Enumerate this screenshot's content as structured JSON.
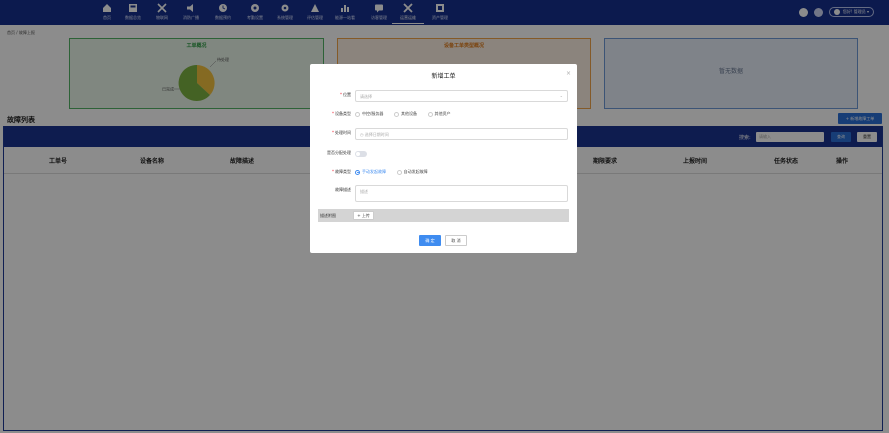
{
  "nav": {
    "items": [
      {
        "label": "首页",
        "icon": "home-icon"
      },
      {
        "label": "数据总览",
        "icon": "dashboard-icon"
      },
      {
        "label": "物联网",
        "icon": "tools-icon"
      },
      {
        "label": "消防广播",
        "icon": "speaker-icon"
      },
      {
        "label": "数据预约",
        "icon": "clock-icon"
      },
      {
        "label": "考勤设置",
        "icon": "settings-gear-icon"
      },
      {
        "label": "系统管理",
        "icon": "gear-icon"
      },
      {
        "label": "评估管理",
        "icon": "people-icon"
      },
      {
        "label": "能源一站看",
        "icon": "chart-icon"
      },
      {
        "label": "访客管理",
        "icon": "chat-icon"
      },
      {
        "label": "运营运维",
        "icon": "wrench-icon"
      },
      {
        "label": "资产管理",
        "icon": "box-icon"
      }
    ],
    "active_index": 10,
    "user_label": "您好! 管理员 ▾"
  },
  "breadcrumb": "首页 / 故障上报",
  "panels": {
    "left_title": "工单概况",
    "pie_labels": [
      "待处理",
      "已完成"
    ],
    "mid_title": "设备工单类型概况",
    "right_empty": "暂无数据"
  },
  "list": {
    "title": "故障列表",
    "add_button": "+ 新增故障工单",
    "search_label": "搜索:",
    "search_placeholder": "请输入",
    "query_button": "查询",
    "reset_button": "重置",
    "columns": [
      "工单号",
      "设备名称",
      "故障描述",
      "期限要求",
      "上报时间",
      "任务状态",
      "操作"
    ]
  },
  "modal": {
    "title": "新增工单",
    "close": "×",
    "location_label": "位置",
    "location_placeholder": "请选择",
    "device_type_label": "设备类型",
    "device_type_options": [
      "中控/服务器",
      "其他设备",
      "其他资产"
    ],
    "time_label": "处理时间",
    "time_placeholder": "选择日期时间",
    "dispatch_label": "是否分配处理",
    "report_type_label": "故障类型",
    "report_type_options": [
      "手动发起故障",
      "自动发起故障"
    ],
    "report_type_selected": 0,
    "desc_label": "故障描述",
    "desc_placeholder": "描述",
    "upload_label": "描述附图",
    "upload_button": "+ 上传",
    "confirm": "确 定",
    "cancel": "取 消"
  },
  "colors": {
    "nav_bg": "#16308f",
    "accent": "#3f8cf0",
    "pie_green": "#7cb342",
    "pie_yellow": "#f3c23e"
  }
}
